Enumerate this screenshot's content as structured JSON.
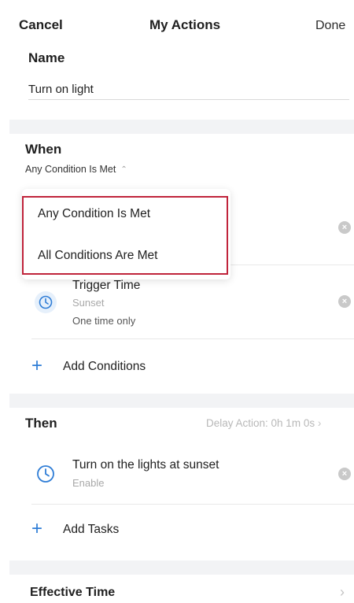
{
  "header": {
    "cancel_label": "Cancel",
    "title": "My Actions",
    "done_label": "Done"
  },
  "name_section": {
    "label": "Name",
    "value": "Turn on light"
  },
  "when_section": {
    "title": "When",
    "condition_mode": "Any Condition Is Met",
    "dropdown_options": [
      "Any Condition Is Met",
      "All Conditions Are Met"
    ],
    "conditions": [
      {
        "title": "Trigger Time",
        "subtitle": "Sunset",
        "detail": "One time only",
        "icon": "clock-icon"
      }
    ],
    "add_label": "Add Conditions"
  },
  "then_section": {
    "title": "Then",
    "delay_label": "Delay Action: 0h 1m 0s",
    "tasks": [
      {
        "title": "Turn on the lights at sunset",
        "subtitle": "Enable",
        "icon": "clock-icon"
      }
    ],
    "add_label": "Add Tasks"
  },
  "effective_time": {
    "label": "Effective Time"
  },
  "colors": {
    "accent": "#2f7dd6",
    "highlight": "#c0243b",
    "band": "#f2f3f5"
  }
}
